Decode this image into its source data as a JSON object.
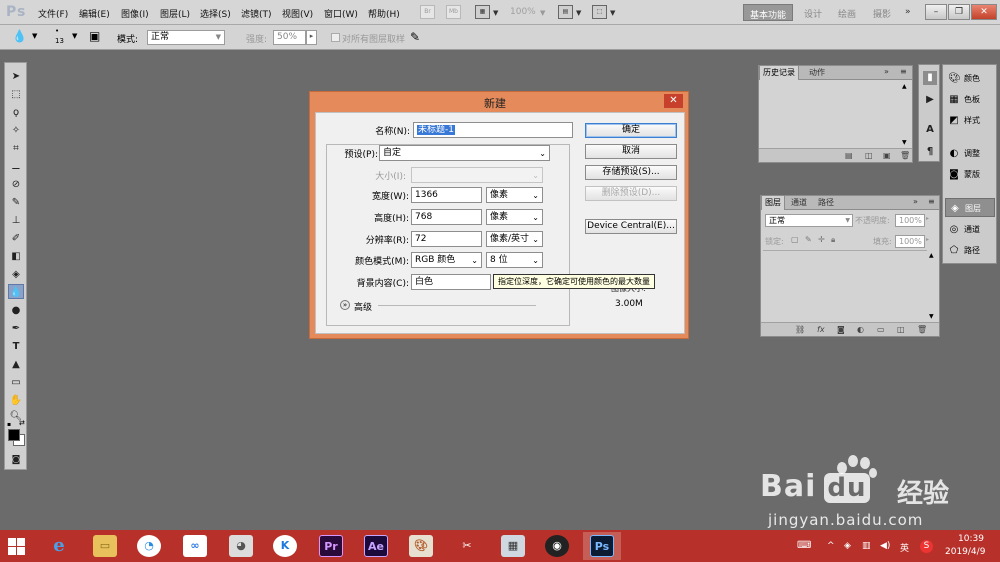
{
  "app": {
    "logo": "Ps"
  },
  "menubar": {
    "items": [
      "文件(F)",
      "编辑(E)",
      "图像(I)",
      "图层(L)",
      "选择(S)",
      "滤镜(T)",
      "视图(V)",
      "窗口(W)",
      "帮助(H)"
    ],
    "zoom": "100%",
    "workspaces": {
      "basic": "基本功能",
      "design": "设计",
      "painting": "绘画",
      "photography": "摄影"
    },
    "more": "»"
  },
  "options": {
    "brush_size": "13",
    "mode_label": "模式:",
    "mode_value": "正常",
    "strength_label": "强度:",
    "strength_value": "50%",
    "sample_all_label": "对所有图层取样"
  },
  "panels": {
    "history": {
      "tab1": "历史记录",
      "tab2": "动作"
    },
    "layers": {
      "tab1": "图层",
      "tab2": "通道",
      "tab3": "路径",
      "blend": "正常",
      "opacity_label": "不透明度:",
      "opacity_value": "100%",
      "lock_label": "锁定:",
      "fill_label": "填充:",
      "fill_value": "100%"
    },
    "dock": {
      "color": "颜色",
      "swatches": "色板",
      "styles": "样式",
      "adjustments": "调整",
      "masks": "蒙版",
      "layers": "图层",
      "channels": "通道",
      "paths": "路径"
    }
  },
  "dialog": {
    "title": "新建",
    "name_label": "名称(N):",
    "name_value": "未标题-1",
    "preset_label": "预设(P):",
    "preset_value": "自定",
    "size_label": "大小(I):",
    "width_label": "宽度(W):",
    "width_value": "1366",
    "width_unit": "像素",
    "height_label": "高度(H):",
    "height_value": "768",
    "height_unit": "像素",
    "resolution_label": "分辨率(R):",
    "resolution_value": "72",
    "resolution_unit": "像素/英寸",
    "colormode_label": "颜色模式(M):",
    "colormode_value": "RGB 颜色",
    "bitdepth_value": "8 位",
    "background_label": "背景内容(C):",
    "background_value": "白色",
    "advanced_label": "高级",
    "ok": "确定",
    "cancel": "取消",
    "save_preset": "存储预设(S)...",
    "delete_preset": "删除预设(D)...",
    "device_central": "Device Central(E)...",
    "image_size_label": "图像大小:",
    "image_size_value": "3.00M",
    "tooltip": "指定位深度，它确定可使用颜色的最大数量"
  },
  "taskbar": {
    "tray_ime": "英",
    "time": "10:39",
    "date": "2019/4/9",
    "apps": {
      "premiere": "Pr",
      "after_effects": "Ae",
      "photoshop": "Ps"
    }
  },
  "watermark": {
    "brand": "Bai",
    "brand2": "du",
    "cn": "经验",
    "url": "jingyan.baidu.com"
  }
}
